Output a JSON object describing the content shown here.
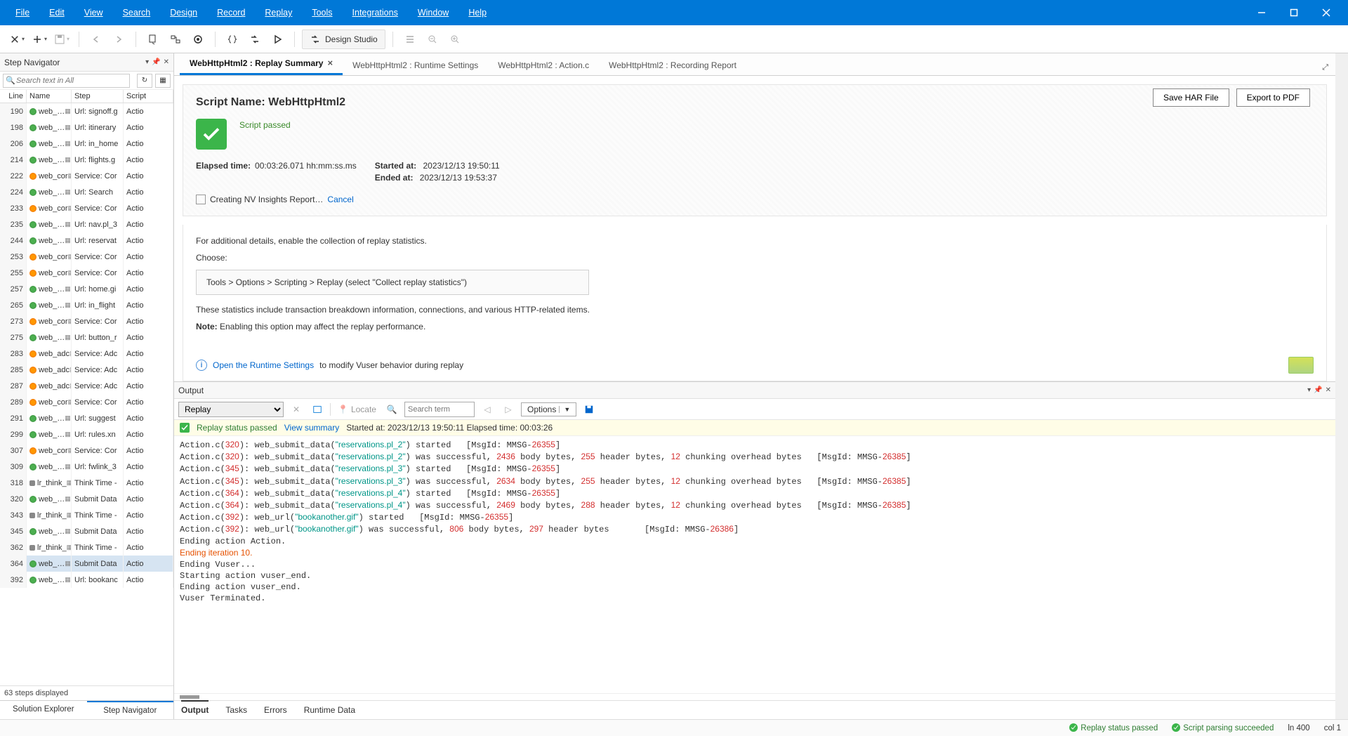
{
  "menubar": [
    "File",
    "Edit",
    "View",
    "Search",
    "Design",
    "Record",
    "Replay",
    "Tools",
    "Integrations",
    "Window",
    "Help"
  ],
  "toolbar": {
    "design_studio": "Design Studio"
  },
  "step_nav": {
    "title": "Step Navigator",
    "search_placeholder": "Search text in All",
    "cols": {
      "line": "Line",
      "name": "Name",
      "step": "Step",
      "script": "Script"
    },
    "rows": [
      {
        "line": "190",
        "name": "web_…",
        "step": "Url: signoff.g",
        "script": "Actio",
        "ico": "g"
      },
      {
        "line": "198",
        "name": "web_…",
        "step": "Url: itinerary",
        "script": "Actio",
        "ico": "g"
      },
      {
        "line": "206",
        "name": "web_…",
        "step": "Url: in_home",
        "script": "Actio",
        "ico": "g"
      },
      {
        "line": "214",
        "name": "web_…",
        "step": "Url: flights.g",
        "script": "Actio",
        "ico": "g"
      },
      {
        "line": "222",
        "name": "web_cor",
        "step": "Service: Cor",
        "script": "Actio",
        "ico": "o"
      },
      {
        "line": "224",
        "name": "web_…",
        "step": "Url: Search",
        "script": "Actio",
        "ico": "g"
      },
      {
        "line": "233",
        "name": "web_cor",
        "step": "Service: Cor",
        "script": "Actio",
        "ico": "o"
      },
      {
        "line": "235",
        "name": "web_…",
        "step": "Url: nav.pl_3",
        "script": "Actio",
        "ico": "g"
      },
      {
        "line": "244",
        "name": "web_…",
        "step": "Url: reservat",
        "script": "Actio",
        "ico": "g"
      },
      {
        "line": "253",
        "name": "web_cor",
        "step": "Service: Cor",
        "script": "Actio",
        "ico": "o"
      },
      {
        "line": "255",
        "name": "web_cor",
        "step": "Service: Cor",
        "script": "Actio",
        "ico": "o"
      },
      {
        "line": "257",
        "name": "web_…",
        "step": "Url: home.gi",
        "script": "Actio",
        "ico": "g"
      },
      {
        "line": "265",
        "name": "web_…",
        "step": "Url: in_flight",
        "script": "Actio",
        "ico": "g"
      },
      {
        "line": "273",
        "name": "web_cor",
        "step": "Service: Cor",
        "script": "Actio",
        "ico": "o"
      },
      {
        "line": "275",
        "name": "web_…",
        "step": "Url: button_r",
        "script": "Actio",
        "ico": "g"
      },
      {
        "line": "283",
        "name": "web_adc",
        "step": "Service: Adc",
        "script": "Actio",
        "ico": "o"
      },
      {
        "line": "285",
        "name": "web_adc",
        "step": "Service: Adc",
        "script": "Actio",
        "ico": "o"
      },
      {
        "line": "287",
        "name": "web_adc",
        "step": "Service: Adc",
        "script": "Actio",
        "ico": "o"
      },
      {
        "line": "289",
        "name": "web_cor",
        "step": "Service: Cor",
        "script": "Actio",
        "ico": "o"
      },
      {
        "line": "291",
        "name": "web_…",
        "step": "Url: suggest",
        "script": "Actio",
        "ico": "g"
      },
      {
        "line": "299",
        "name": "web_…",
        "step": "Url: rules.xn",
        "script": "Actio",
        "ico": "g"
      },
      {
        "line": "307",
        "name": "web_cor",
        "step": "Service: Cor",
        "script": "Actio",
        "ico": "o"
      },
      {
        "line": "309",
        "name": "web_…",
        "step": "Url: fwlink_3",
        "script": "Actio",
        "ico": "g"
      },
      {
        "line": "318",
        "name": "lr_think_",
        "step": "Think Time -",
        "script": "Actio",
        "ico": "t"
      },
      {
        "line": "320",
        "name": "web_…",
        "step": "Submit Data",
        "script": "Actio",
        "ico": "g"
      },
      {
        "line": "343",
        "name": "lr_think_",
        "step": "Think Time -",
        "script": "Actio",
        "ico": "t"
      },
      {
        "line": "345",
        "name": "web_…",
        "step": "Submit Data",
        "script": "Actio",
        "ico": "g"
      },
      {
        "line": "362",
        "name": "lr_think_",
        "step": "Think Time -",
        "script": "Actio",
        "ico": "t"
      },
      {
        "line": "364",
        "name": "web_…",
        "step": "Submit Data",
        "script": "Actio",
        "ico": "g",
        "sel": true
      },
      {
        "line": "392",
        "name": "web_…",
        "step": "Url: bookanc",
        "script": "Actio",
        "ico": "g"
      }
    ],
    "footer": "63 steps displayed",
    "tabs": {
      "explorer": "Solution Explorer",
      "navigator": "Step Navigator"
    }
  },
  "tabs": [
    {
      "label": "WebHttpHtml2 : Replay Summary",
      "active": true,
      "close": true
    },
    {
      "label": "WebHttpHtml2 : Runtime Settings"
    },
    {
      "label": "WebHttpHtml2 : Action.c"
    },
    {
      "label": "WebHttpHtml2 : Recording Report"
    }
  ],
  "summary": {
    "title_label": "Script Name: ",
    "title_value": "WebHttpHtml2",
    "passed": "Script passed",
    "elapsed_label": "Elapsed time:",
    "elapsed_val": "00:03:26.071 hh:mm:ss.ms",
    "started_label": "Started at:",
    "started_val": "2023/12/13 19:50:11",
    "ended_label": "Ended at:",
    "ended_val": "2023/12/13 19:53:37",
    "nv": "Creating NV Insights Report…",
    "cancel": "Cancel",
    "detail1": "For additional details, enable the collection of replay statistics.",
    "choose": "Choose:",
    "hint": "Tools > Options > Scripting > Replay (select \"Collect replay statistics\")",
    "detail2": "These statistics include transaction breakdown information, connections, and various HTTP-related items.",
    "note_label": "Note:",
    "note_text": " Enabling this option may affect the replay performance.",
    "open_rt": "Open the Runtime Settings",
    "open_rt_suffix": " to modify Vuser behavior during replay",
    "save_har": "Save HAR File",
    "export_pdf": "Export to PDF"
  },
  "output": {
    "title": "Output",
    "select": "Replay",
    "locate": "Locate",
    "search_placeholder": "Search term",
    "options": "Options",
    "status_passed": "Replay status passed",
    "view_summary": "View summary",
    "status_meta": "Started at: 2023/12/13 19:50:11 Elapsed time: 00:03:26",
    "tabs": {
      "output": "Output",
      "tasks": "Tasks",
      "errors": "Errors",
      "runtime": "Runtime Data"
    }
  },
  "log_lines": [
    {
      "pre": "Action.c(",
      "n1": "320",
      "mid": "): web_submit_data(",
      "q": "\"reservations.pl_2\"",
      "post": ") started",
      "tail": "   [MsgId: MMSG-",
      "n2": "26355",
      "end": "]"
    },
    {
      "pre": "Action.c(",
      "n1": "320",
      "mid": "): web_submit_data(",
      "q": "\"reservations.pl_2\"",
      "post": ") was successful, ",
      "nn": [
        "2436",
        " body bytes, ",
        "255",
        " header bytes, ",
        "12",
        " chunking overhead bytes"
      ],
      "tail": "   [MsgId: MMSG-",
      "n2": "26385",
      "end": "]"
    },
    {
      "pre": "Action.c(",
      "n1": "345",
      "mid": "): web_submit_data(",
      "q": "\"reservations.pl_3\"",
      "post": ") started",
      "tail": "   [MsgId: MMSG-",
      "n2": "26355",
      "end": "]"
    },
    {
      "pre": "Action.c(",
      "n1": "345",
      "mid": "): web_submit_data(",
      "q": "\"reservations.pl_3\"",
      "post": ") was successful, ",
      "nn": [
        "2634",
        " body bytes, ",
        "255",
        " header bytes, ",
        "12",
        " chunking overhead bytes"
      ],
      "tail": "   [MsgId: MMSG-",
      "n2": "26385",
      "end": "]"
    },
    {
      "pre": "Action.c(",
      "n1": "364",
      "mid": "): web_submit_data(",
      "q": "\"reservations.pl_4\"",
      "post": ") started",
      "tail": "   [MsgId: MMSG-",
      "n2": "26355",
      "end": "]"
    },
    {
      "pre": "Action.c(",
      "n1": "364",
      "mid": "): web_submit_data(",
      "q": "\"reservations.pl_4\"",
      "post": ") was successful, ",
      "nn": [
        "2469",
        " body bytes, ",
        "288",
        " header bytes, ",
        "12",
        " chunking overhead bytes"
      ],
      "tail": "   [MsgId: MMSG-",
      "n2": "26385",
      "end": "]"
    },
    {
      "pre": "Action.c(",
      "n1": "392",
      "mid": "): web_url(",
      "q": "\"bookanother.gif\"",
      "post": ") started",
      "tail": "   [MsgId: MMSG-",
      "n2": "26355",
      "end": "]"
    },
    {
      "pre": "Action.c(",
      "n1": "392",
      "mid": "): web_url(",
      "q": "\"bookanother.gif\"",
      "post": ") was successful, ",
      "nn": [
        "806",
        " body bytes, ",
        "297",
        " header bytes"
      ],
      "tail": "       [MsgId: MMSG-",
      "n2": "26386",
      "end": "]"
    },
    {
      "plain": "Ending action Action."
    },
    {
      "orange": "Ending iteration 10."
    },
    {
      "plain": "Ending Vuser..."
    },
    {
      "plain": "Starting action vuser_end."
    },
    {
      "plain": "Ending action vuser_end."
    },
    {
      "plain": "Vuser Terminated."
    }
  ],
  "statusbar": {
    "replay": "Replay status passed",
    "parse": "Script parsing succeeded",
    "ln": "ln 400",
    "col": "col 1"
  }
}
